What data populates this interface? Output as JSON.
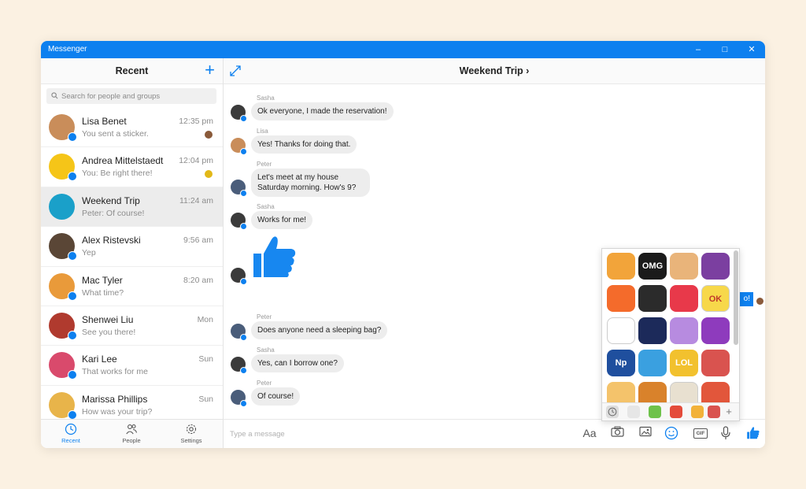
{
  "window": {
    "title": "Messenger"
  },
  "sidebar": {
    "heading": "Recent",
    "search_placeholder": "Search for people and groups",
    "conversations": [
      {
        "name": "Lisa Benet",
        "preview": "You sent a sticker.",
        "time": "12:35 pm",
        "color": "#c98d5a"
      },
      {
        "name": "Andrea Mittelstaedt",
        "preview": "You: Be right there!",
        "time": "12:04 pm",
        "color": "#f5c518"
      },
      {
        "name": "Weekend Trip",
        "preview": "Peter: Of course!",
        "time": "11:24 am",
        "color": "#1aa0c9"
      },
      {
        "name": "Alex Ristevski",
        "preview": "Yep",
        "time": "9:56 am",
        "color": "#5a4636"
      },
      {
        "name": "Mac Tyler",
        "preview": "What time?",
        "time": "8:20 am",
        "color": "#e99a3a"
      },
      {
        "name": "Shenwei Liu",
        "preview": "See you there!",
        "time": "Mon",
        "color": "#b03a2e"
      },
      {
        "name": "Kari Lee",
        "preview": "That works for me",
        "time": "Sun",
        "color": "#d94a6c"
      },
      {
        "name": "Marissa Phillips",
        "preview": "How was your trip?",
        "time": "Sun",
        "color": "#e8b44a"
      }
    ],
    "nav": [
      {
        "label": "Recent"
      },
      {
        "label": "People"
      },
      {
        "label": "Settings"
      }
    ]
  },
  "chat": {
    "title": "Weekend Trip",
    "messages": [
      {
        "sender": "Sasha",
        "text": "Ok everyone, I made the reservation!",
        "color": "#3b3b3b"
      },
      {
        "sender": "Lisa",
        "text": "Yes! Thanks for doing that.",
        "color": "#c98d5a"
      },
      {
        "sender": "Peter",
        "text": "Let's meet at my house Saturday morning. How's 9?",
        "color": "#4a5d7a"
      },
      {
        "sender": "Sasha",
        "text": "Works for me!",
        "color": "#3b3b3b"
      },
      {
        "sender": "Peter",
        "text": "Does anyone need a sleeping bag?",
        "color": "#4a5d7a"
      },
      {
        "sender": "Sasha",
        "text": "Yes, can I borrow one?",
        "color": "#3b3b3b"
      },
      {
        "sender": "Peter",
        "text": "Of course!",
        "color": "#4a5d7a"
      }
    ],
    "outgoing_fragment": "o!",
    "composer_placeholder": "Type a message",
    "text_format_label": "Aa",
    "gif_label": "GIF"
  },
  "stickers": {
    "items": [
      "",
      "OMG",
      "",
      "",
      "",
      "",
      "",
      "OK",
      "",
      "",
      "",
      "",
      "Np",
      "",
      "LOL",
      "",
      "",
      "",
      "",
      ""
    ],
    "colors": [
      "#f2a43a",
      "#1b1b1b",
      "#e9b47a",
      "#7b3fa0",
      "#f46b2b",
      "#2b2b2b",
      "#e8394a",
      "#f7d84a",
      "#ffffff",
      "#1c2a5a",
      "#b78be0",
      "#8e3bbd",
      "#1f4f9e",
      "#3aa0e0",
      "#f2c12e",
      "#d9534f",
      "#f4c36b",
      "#d9822b",
      "#e8e0d0",
      "#e2563b"
    ]
  }
}
